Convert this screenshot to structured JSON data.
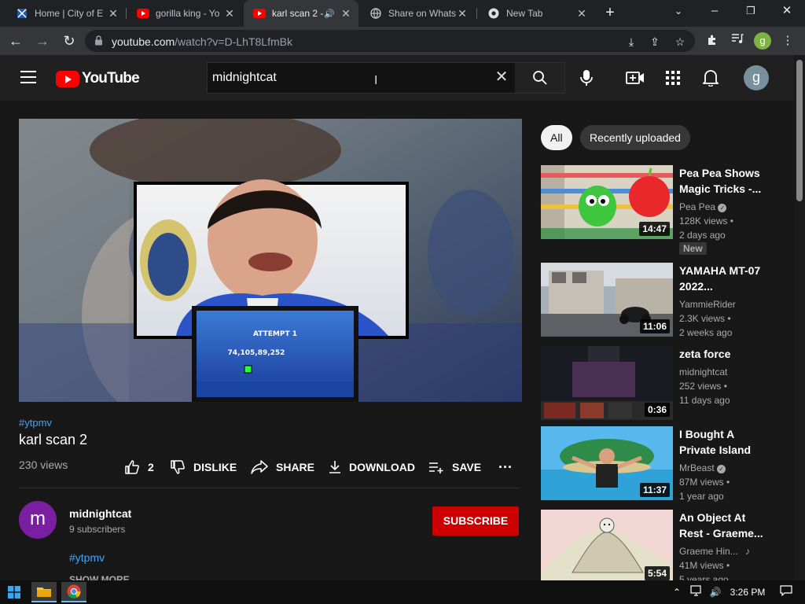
{
  "browser": {
    "tabs": [
      {
        "title": "Home | City of E",
        "icon": "city-favicon"
      },
      {
        "title": "gorilla king - Yo",
        "icon": "youtube-favicon"
      },
      {
        "title": "karl scan 2 -",
        "icon": "youtube-favicon",
        "active": true,
        "audio": true
      },
      {
        "title": "Share on Whats",
        "icon": "globe-favicon"
      },
      {
        "title": "New Tab",
        "icon": "chrome-favicon"
      }
    ],
    "url_host": "youtube.com",
    "url_path": "/watch?v=D-LhT8LfmBk",
    "profile_initial": "g"
  },
  "youtube": {
    "logo_text": "YouTube",
    "search_value": "midnightcat",
    "avatar_initial": "g"
  },
  "video": {
    "hashtag": "#ytpmv",
    "title": "karl scan 2",
    "views": "230 views",
    "likes": "2",
    "dislike_label": "DISLIKE",
    "share_label": "SHARE",
    "download_label": "DOWNLOAD",
    "save_label": "SAVE",
    "overlay_text_1": "ATTEMPT 1",
    "overlay_text_2": "74,105,89,252"
  },
  "channel": {
    "initial": "m",
    "name": "midnightcat",
    "subscribers": "9 subscribers",
    "subscribe_label": "SUBSCRIBE",
    "description_tag": "#ytpmv",
    "show_more": "SHOW MORE"
  },
  "chips": [
    "All",
    "Recently uploaded"
  ],
  "recommendations": [
    {
      "title": "Pea Pea Shows Magic Tricks -...",
      "channel": "Pea Pea",
      "verified": true,
      "views": "128K views •",
      "age": "2 days ago",
      "badge": "New",
      "duration": "14:47"
    },
    {
      "title": "YAMAHA MT-07 2022...",
      "channel": "YammieRider",
      "views": "2.3K views •",
      "age": "2 weeks ago",
      "duration": "11:06"
    },
    {
      "title": "zeta force",
      "channel": "midnightcat",
      "views": "252 views •",
      "age": "11 days ago",
      "duration": "0:36"
    },
    {
      "title": "I Bought A Private Island",
      "channel": "MrBeast",
      "verified": true,
      "views": "87M views •",
      "age": "1 year ago",
      "duration": "11:37"
    },
    {
      "title": "An Object At Rest - Graeme...",
      "channel": "Graeme Hin...",
      "music": true,
      "views": "41M views •",
      "age": "5 years ago",
      "duration": "5:54"
    }
  ],
  "taskbar": {
    "time": "3:26 PM"
  },
  "colors": {
    "yt_red": "#ff0000",
    "subscribe_red": "#cc0000",
    "link_blue": "#3ea6ff",
    "bg": "#181818"
  }
}
